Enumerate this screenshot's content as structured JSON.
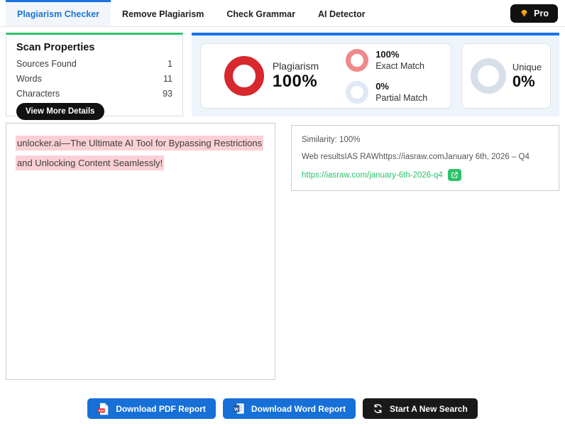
{
  "header": {
    "tabs": [
      {
        "label": "Plagiarism Checker",
        "active": true
      },
      {
        "label": "Remove Plagiarism",
        "active": false
      },
      {
        "label": "Check Grammar",
        "active": false
      },
      {
        "label": "AI Detector",
        "active": false
      }
    ],
    "pro_button": {
      "label": "Pro",
      "icon": "diamond-icon"
    }
  },
  "scan_properties": {
    "title": "Scan Properties",
    "rows": [
      {
        "label": "Sources Found",
        "value": "1"
      },
      {
        "label": "Words",
        "value": "11"
      },
      {
        "label": "Characters",
        "value": "93"
      }
    ],
    "view_more_label": "View More Details"
  },
  "results": {
    "plagiarism": {
      "label": "Plagiarism",
      "value": "100%"
    },
    "exact_match": {
      "value": "100%",
      "label": "Exact Match"
    },
    "partial_match": {
      "value": "0%",
      "label": "Partial Match"
    },
    "unique": {
      "label": "Unique",
      "value": "0%"
    }
  },
  "document": {
    "highlighted_text": "unlocker.ai—The Ultimate AI Tool for Bypassing Restrictions and Unlocking Content Seamlessly!"
  },
  "source_result": {
    "similarity": "Similarity: 100%",
    "web_result": "Web resultsIAS RAWhttps://iasraw.comJanuary 6th, 2026 – Q4",
    "link_text": "https://iasraw.com/january-6th-2026-q4",
    "external_link_icon": "external-link-icon"
  },
  "footer": {
    "buttons": [
      {
        "label": "Download PDF Report",
        "icon": "pdf-file-icon"
      },
      {
        "label": "Download Word Report",
        "icon": "word-file-icon"
      },
      {
        "label": "Start A New Search",
        "icon": "refresh-icon"
      }
    ]
  },
  "icons": {
    "pdf_badge": "PDF",
    "word_badge": "W"
  },
  "colors": {
    "accent_blue": "#1a73e8",
    "active_tab_text": "#1b74d3",
    "panel_green": "#2dc26b",
    "plagiarism_red": "#d6282d",
    "exact_match_pink": "#f0898a",
    "partial_match_pale": "#dfe8f4",
    "unique_grey": "#d7dfeb",
    "highlight_pink": "#fbd0d5",
    "link_green": "#2dc26b",
    "button_blue": "#1670d8",
    "button_black": "#191919",
    "results_bg": "#eef4fc"
  }
}
